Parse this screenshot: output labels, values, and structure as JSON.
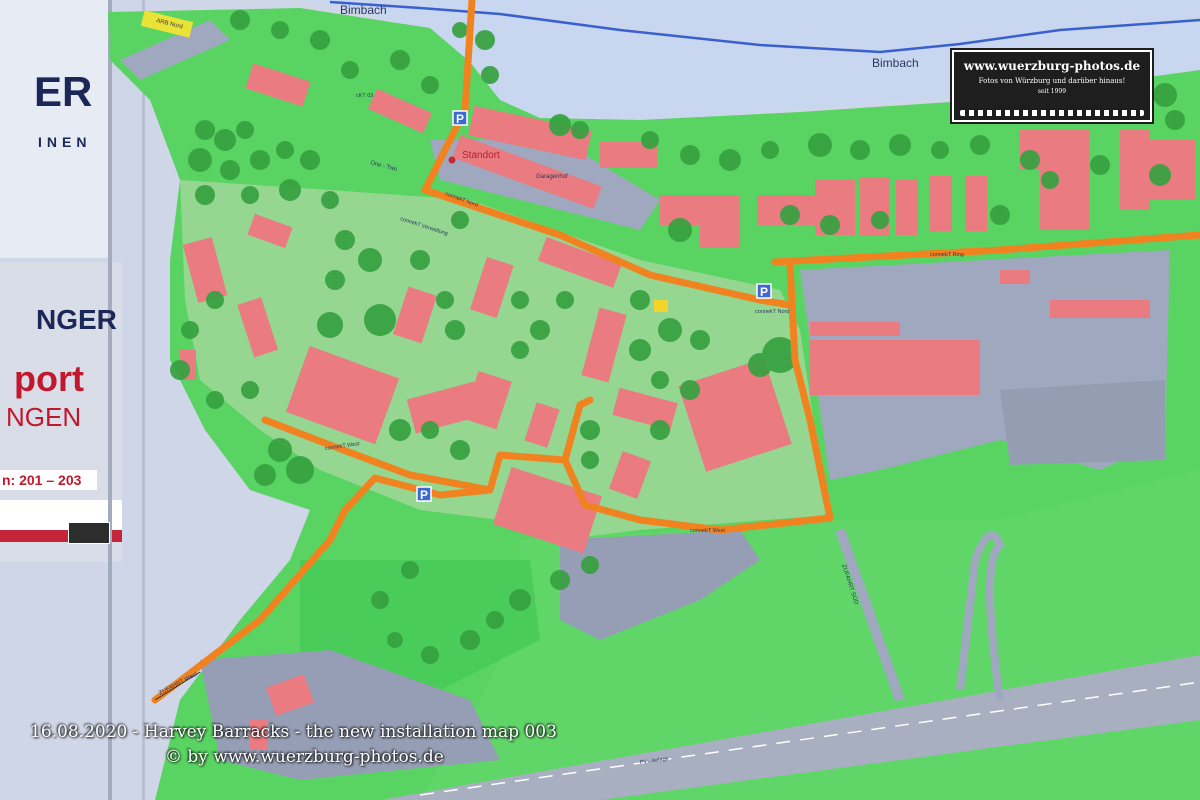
{
  "board": {
    "logo_fragment": "ER",
    "logo_sub_fragment": "INEN",
    "panel_brand_fragment": "NGER",
    "panel_line1_fragment": "port",
    "panel_line2_fragment": "NGEN",
    "panel_tagline": "n: 201 – 203"
  },
  "map": {
    "labels": {
      "river_top": "Bimbach",
      "river_right": "Bimbach",
      "standort": "Standort",
      "garagenhof": "Garagenhof",
      "connekt_nord_1": "connekT Nord",
      "connekt_nord_2": "connekT Nord",
      "connekt_verwaltung": "connekT Verwaltung",
      "connekt_west_1": "connekT West",
      "connekt_west_2": "connekT West",
      "connekt_ring": "connekT Ring",
      "one_two": "One - Two",
      "zufahrt_sued": "ZUFAHRT SÜD",
      "zufahrt_west": "ZUFAHRT West",
      "arb_nord": "ARB Nord",
      "ckt": "cKT 03",
      "pv_anlage": "PV - Anlage",
      "parking": "P"
    },
    "colors": {
      "field": "#4fd25a",
      "road": "#f07c13",
      "building": "#e8737a",
      "paved": "#9aa3ba",
      "water": "#6fa8e4",
      "tree": "#2a9c35",
      "parking_sign": "#2f5fd1"
    }
  },
  "watermark": {
    "site": "www.wuerzburg-photos.de",
    "subtitle": "Fotos von Würzburg und darüber hinaus!",
    "since": "seit 1999"
  },
  "captions": {
    "line1": "16.08.2020 - Harvey Barracks - the new installation map 003",
    "line2": "© by www.wuerzburg-photos.de"
  }
}
